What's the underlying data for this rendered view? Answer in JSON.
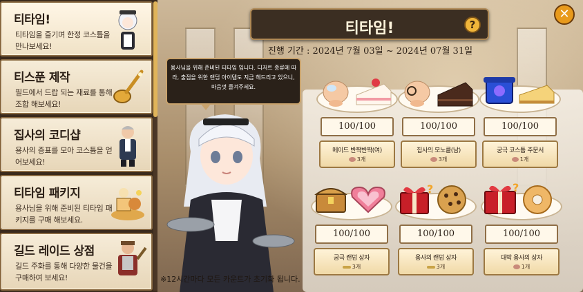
{
  "sidebar": {
    "items": [
      {
        "title": "티타임!",
        "desc": "티타임을 즐기며 한정 코스튬을 만나보세요!"
      },
      {
        "title": "티스푼 제작",
        "desc": "필드에서 드랍 되는 재료를 통해 조합 해보세요!"
      },
      {
        "title": "집사의 코디샵",
        "desc": "용사의 증표를 모아 코스튬을 얻어보세요!"
      },
      {
        "title": "티타임 패키지",
        "desc": "용사님을 위해 준비된 티타임 패키지를 구매 해보세요."
      },
      {
        "title": "길드 레이드 상점",
        "desc": "길드 주화를 통해 다양한 물건을 구매하여 보세요!"
      }
    ]
  },
  "header": {
    "title": "티타임!",
    "help": "?",
    "close": "✕",
    "period": "진행 기간 : 2024년 7월 03일 ~ 2024년 07월 31일"
  },
  "speech": "용사님을 위해 준비된 티타임 입니다. 디저트 종류에 따라, 출점을 위한 랜덤 아이템도 지금 헤드리고 있으니, 마음껏 즐겨주세요.",
  "footnote": "※12시간마다 모든 카운트가 초기화 됩니다.",
  "items": [
    {
      "count": "100/100",
      "name": "메이드 반짝반짝(여)",
      "cost": "3개",
      "cost_icon": "cake-icon",
      "accent": "#e97d8b"
    },
    {
      "count": "100/100",
      "name": "집사의 모노클(남)",
      "cost": "3개",
      "cost_icon": "cake-icon",
      "accent": "#4a2a1c"
    },
    {
      "count": "100/100",
      "name": "궁극 코스튬 주문서",
      "cost": "1개",
      "cost_icon": "cake-icon",
      "accent": "#2a4fd6"
    },
    {
      "count": "100/100",
      "name": "궁극 랜덤 상자",
      "cost": "3개",
      "cost_icon": "spoon-icon",
      "accent": "#d49a3a"
    },
    {
      "count": "100/100",
      "name": "용사의 랜덤 상자",
      "cost": "3개",
      "cost_icon": "spoon-icon",
      "accent": "#c81f28"
    },
    {
      "count": "100/100",
      "name": "대박 용사의 상자",
      "cost": "1개",
      "cost_icon": "cake-icon",
      "accent": "#c81f28"
    }
  ],
  "colors": {
    "accent": "#e0b45a",
    "panel": "#3b2e22",
    "card": "#f6ecd8"
  }
}
